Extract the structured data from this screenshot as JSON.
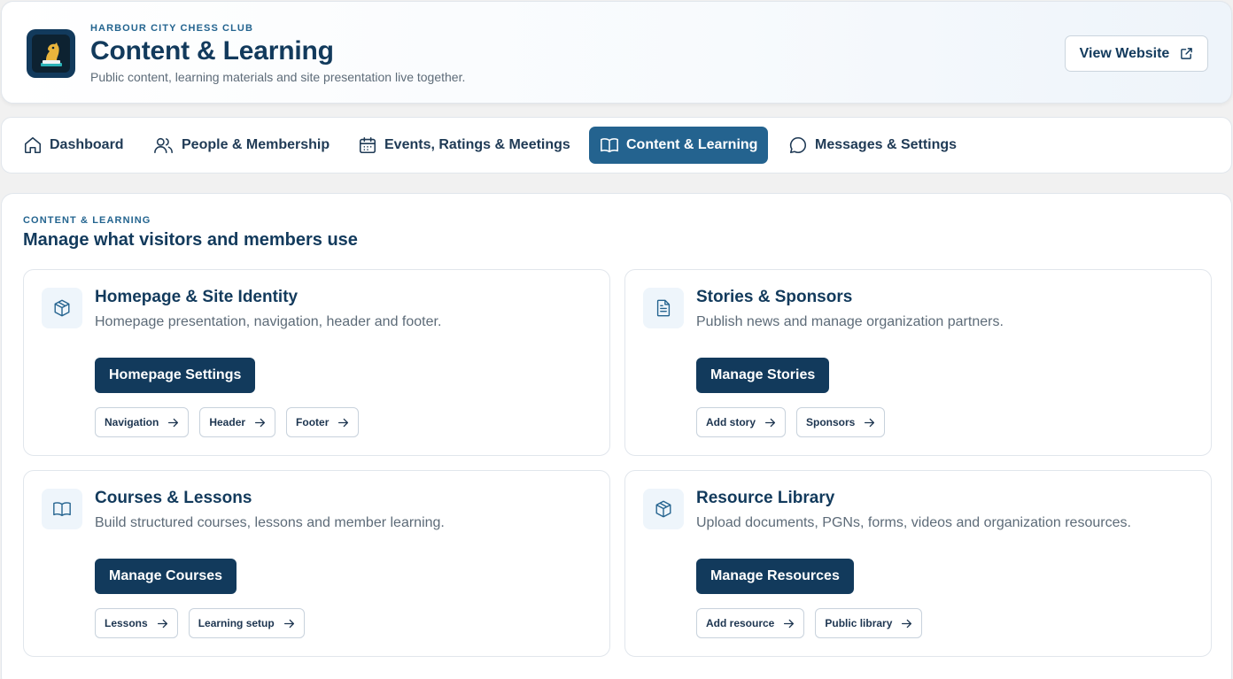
{
  "header": {
    "club_name": "HARBOUR CITY CHESS CLUB",
    "title": "Content & Learning",
    "subtitle": "Public content, learning materials and site presentation live together.",
    "view_website_label": "View Website"
  },
  "tabs": [
    {
      "label": "Dashboard",
      "icon": "home-icon",
      "active": false
    },
    {
      "label": "People & Membership",
      "icon": "users-icon",
      "active": false
    },
    {
      "label": "Events, Ratings & Meetings",
      "icon": "calendar-icon",
      "active": false
    },
    {
      "label": "Content & Learning",
      "icon": "book-icon",
      "active": true
    },
    {
      "label": "Messages & Settings",
      "icon": "message-icon",
      "active": false
    }
  ],
  "section": {
    "eyebrow": "CONTENT & LEARNING",
    "title": "Manage what visitors and members use"
  },
  "cards": [
    {
      "icon": "box-icon",
      "title": "Homepage & Site Identity",
      "description": "Homepage presentation, navigation, header and footer.",
      "primary_label": "Homepage Settings",
      "chips": [
        "Navigation",
        "Header",
        "Footer"
      ]
    },
    {
      "icon": "document-icon",
      "title": "Stories & Sponsors",
      "description": "Publish news and manage organization partners.",
      "primary_label": "Manage Stories",
      "chips": [
        "Add story",
        "Sponsors"
      ]
    },
    {
      "icon": "book-icon",
      "title": "Courses & Lessons",
      "description": "Build structured courses, lessons and member learning.",
      "primary_label": "Manage Courses",
      "chips": [
        "Lessons",
        "Learning setup"
      ]
    },
    {
      "icon": "box-icon",
      "title": "Resource Library",
      "description": "Upload documents, PGNs, forms, videos and organization resources.",
      "primary_label": "Manage Resources",
      "chips": [
        "Add resource",
        "Public library"
      ]
    }
  ],
  "colors": {
    "primary": "#123a5c",
    "active_tab": "#24638f",
    "accent": "#23648f",
    "muted_text": "#5d6b78"
  }
}
